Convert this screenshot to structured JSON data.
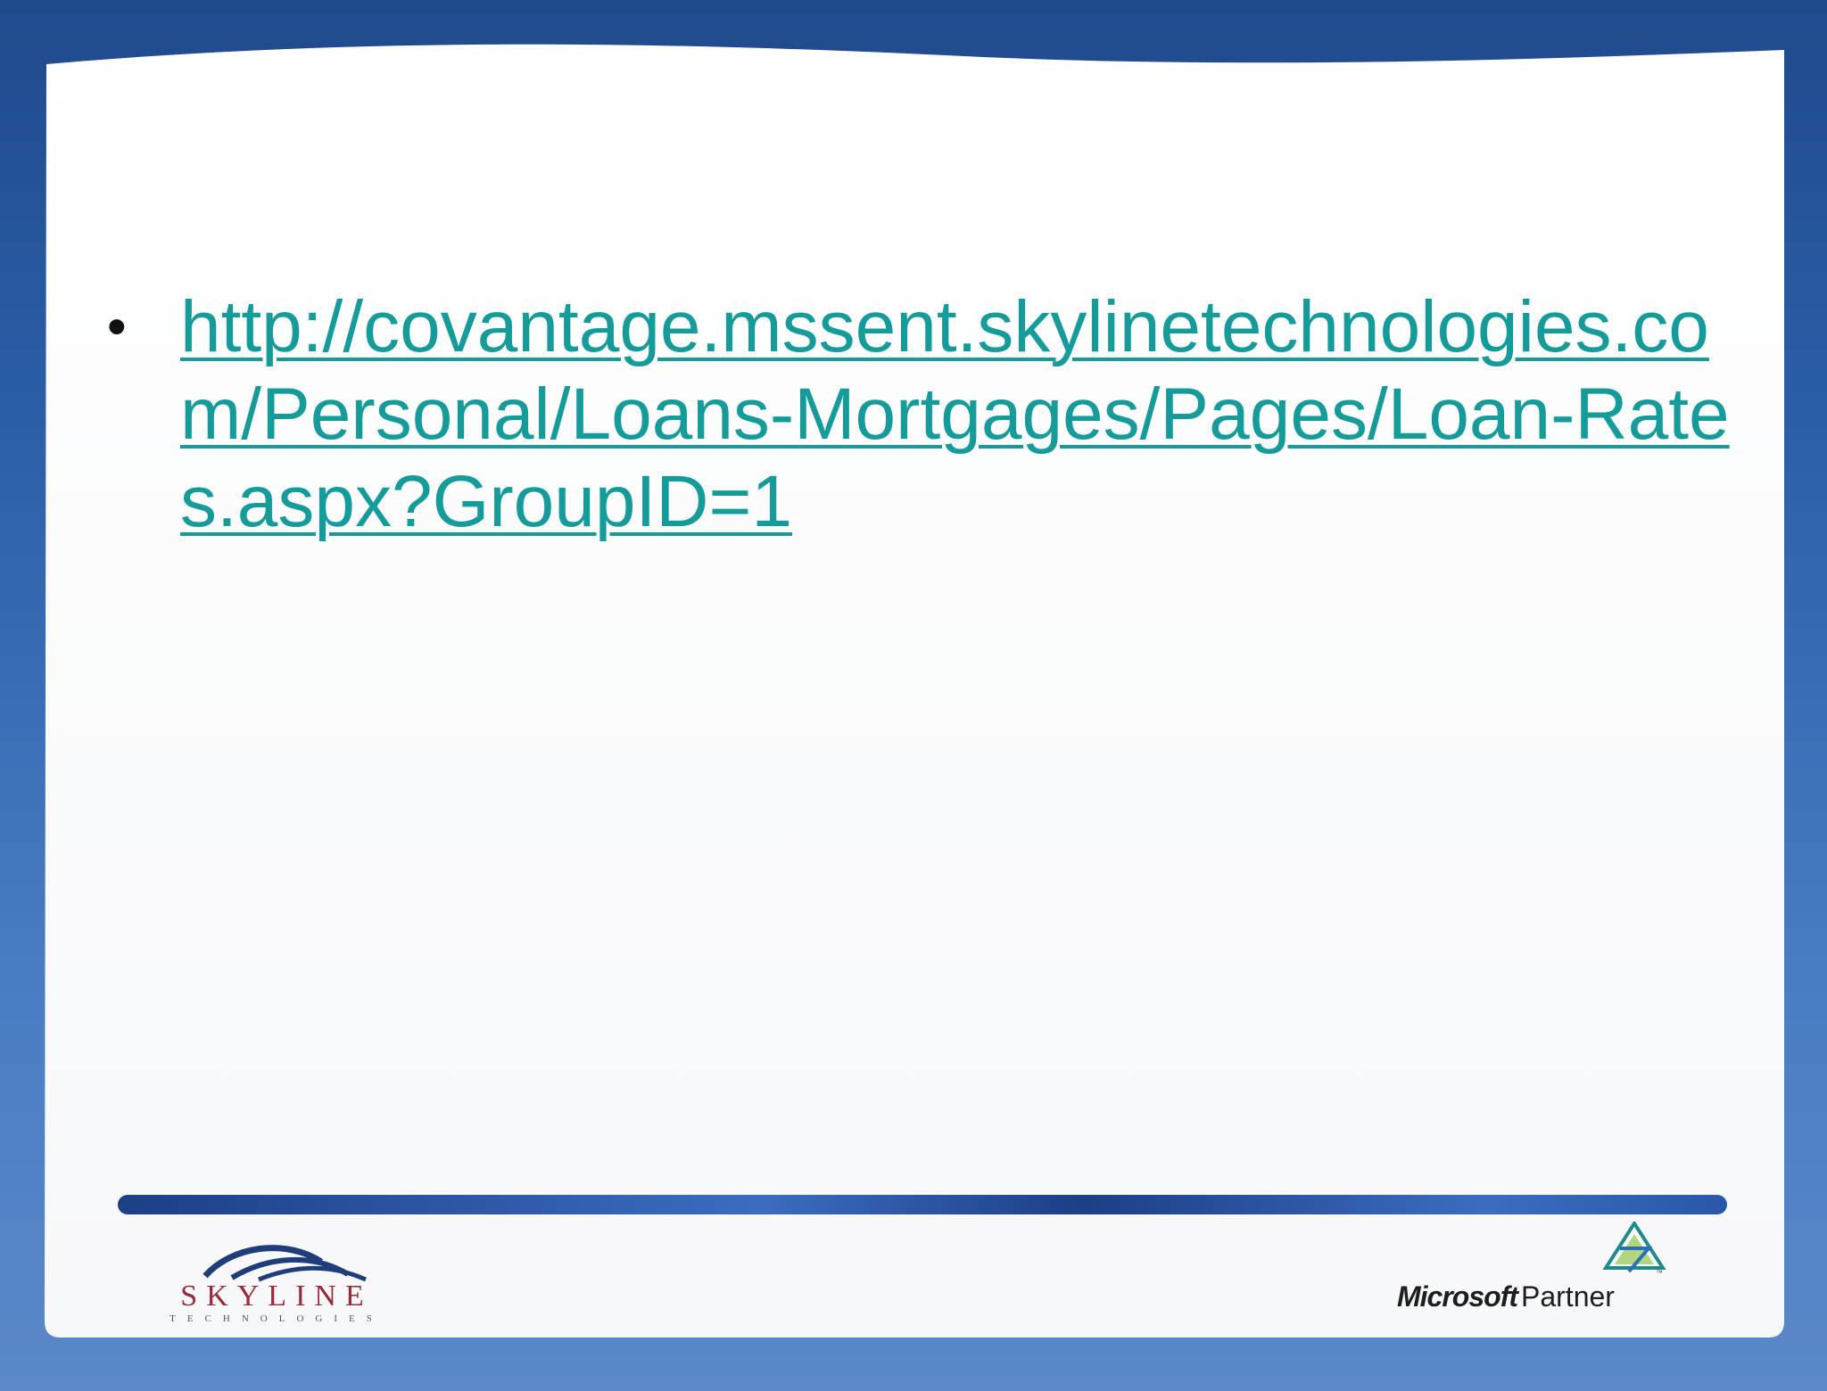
{
  "slide": {
    "link": {
      "text": "http://covantage.mssent.skylinetechnologies.com/Personal/Loans-Mortgages/Pages/Loan-Rates.aspx?GroupID=1",
      "color": "#169b9b"
    },
    "bullet_glyph": "•"
  },
  "footer": {
    "skyline_logo": {
      "wordmark": "SKYLINE",
      "subtitle": "TECHNOLOGIES",
      "color": "#9a2a3a"
    },
    "partner_logo": {
      "brand": "Microsoft",
      "label": "Partner",
      "icon": "microsoft-partner-icon"
    }
  },
  "colors": {
    "background": "#2c5ea8",
    "panel": "#ffffff",
    "divider": "#1c3f86"
  }
}
